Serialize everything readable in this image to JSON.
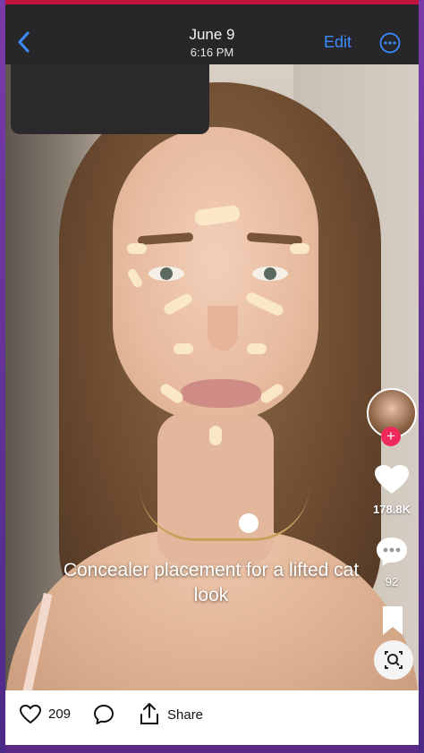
{
  "header": {
    "date": "June 9",
    "time": "6:16 PM",
    "edit_label": "Edit",
    "back_icon": "chevron-left-icon",
    "more_icon": "ellipsis-circle-icon"
  },
  "video": {
    "caption": "Concealer placement for a lifted cat look",
    "likes": "178.8K",
    "comments": "92",
    "icons": [
      "heart-icon",
      "comment-bubble-icon",
      "bookmark-icon",
      "visual-search-icon",
      "follow-plus-icon"
    ]
  },
  "bottom_bar": {
    "likes": "209",
    "share_label": "Share",
    "icons": [
      "heart-outline-icon",
      "comment-outline-icon",
      "share-icon"
    ]
  },
  "colors": {
    "accent_blue": "#3b8cff",
    "follow_red": "#ee2a5b",
    "frame_purple": "#5b2a86"
  }
}
